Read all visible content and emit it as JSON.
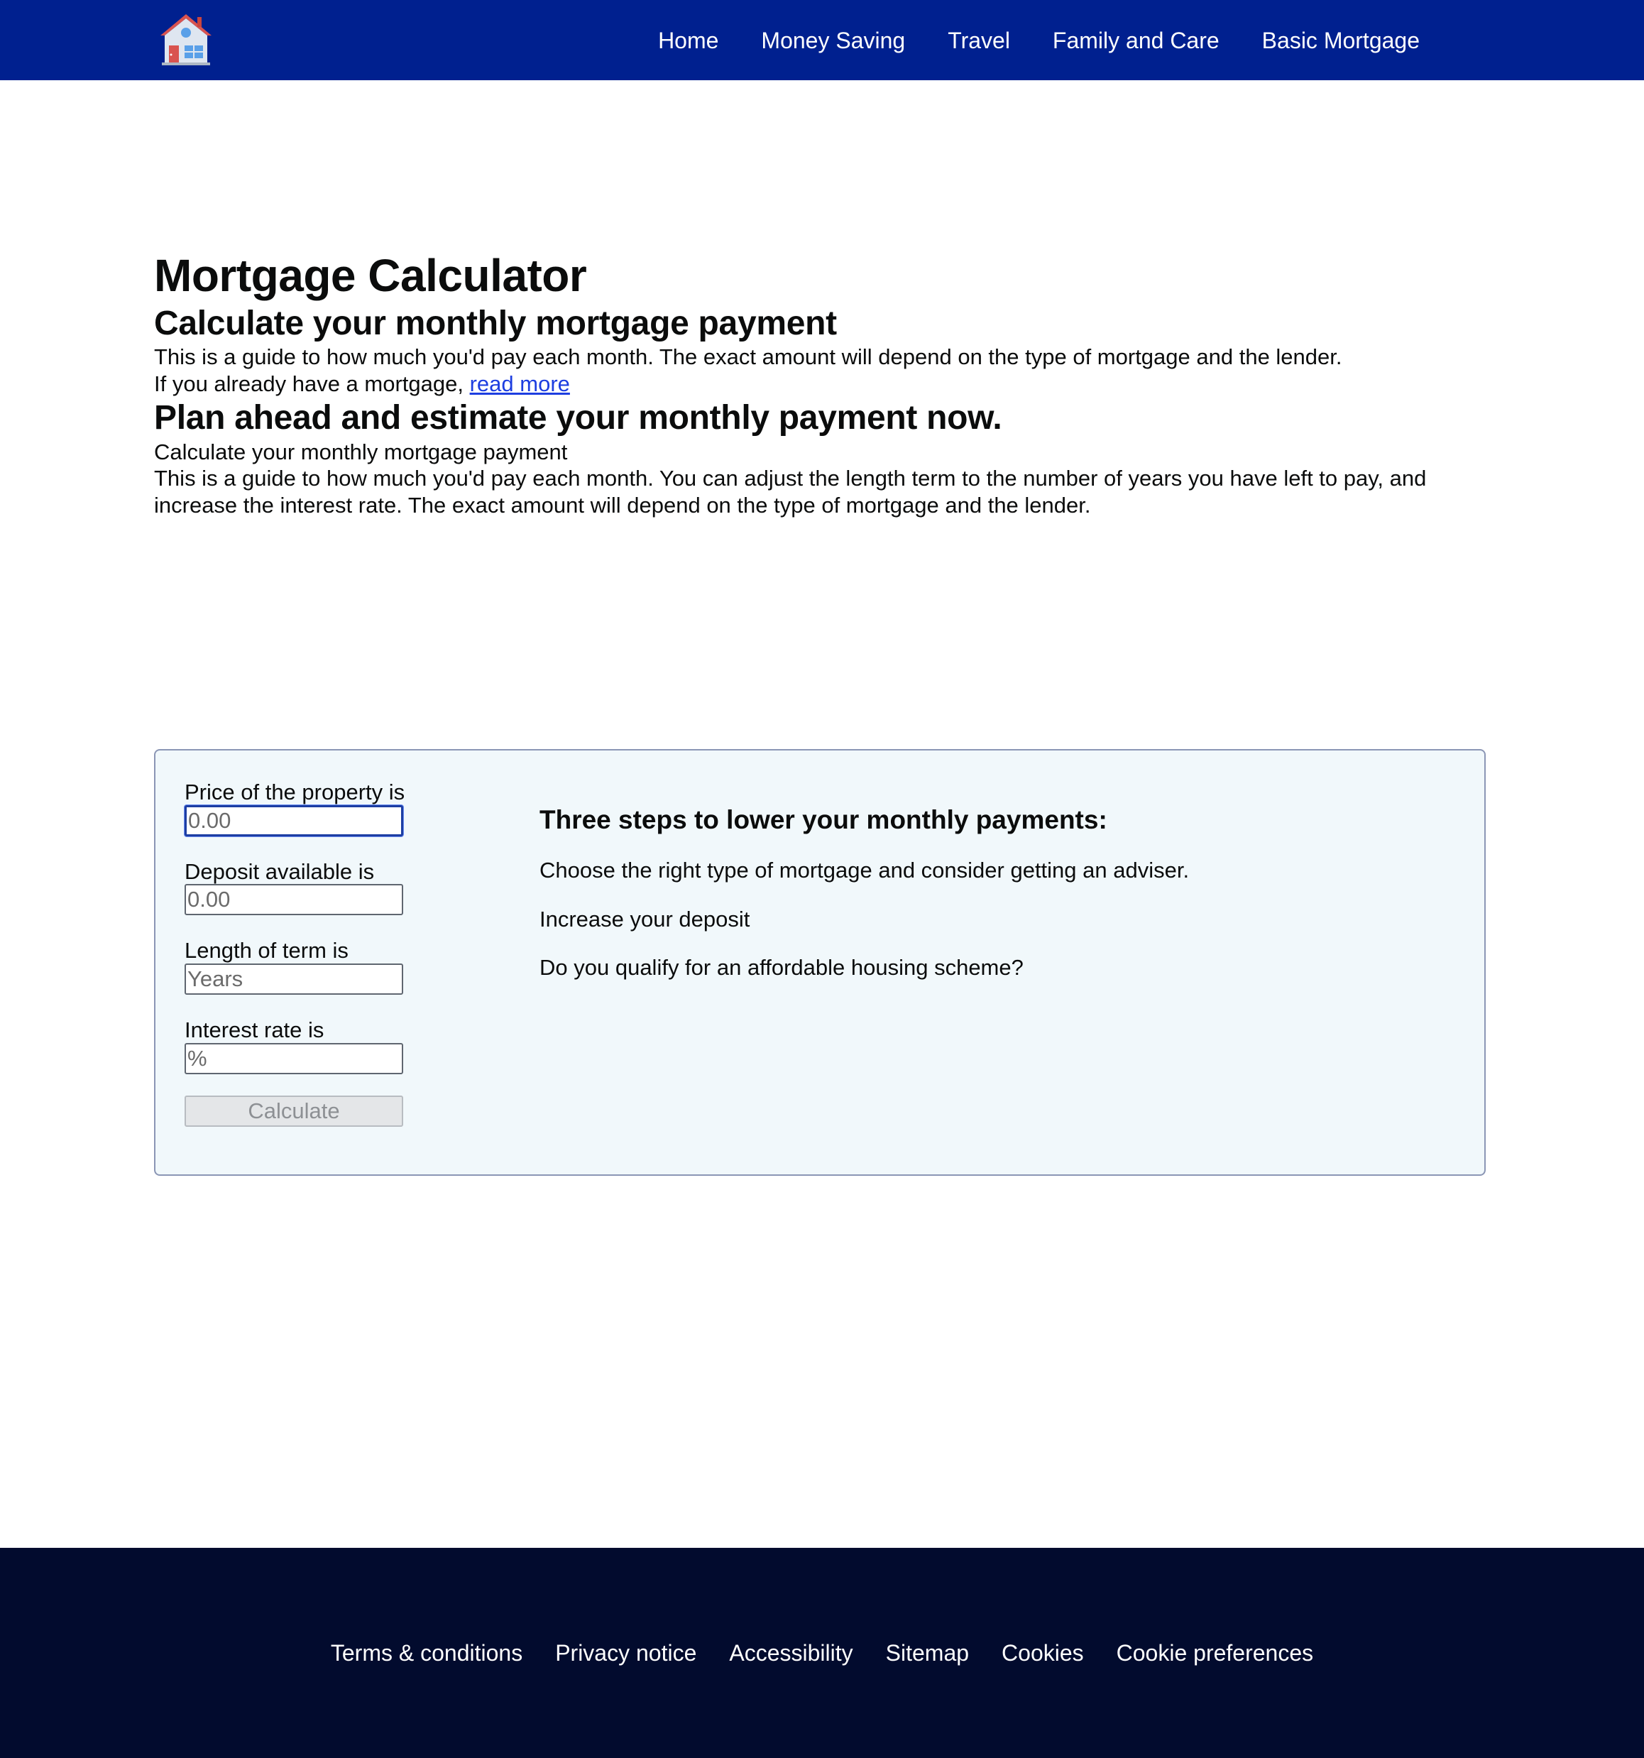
{
  "header": {
    "logo_icon": "house-icon",
    "nav": [
      {
        "label": "Home"
      },
      {
        "label": "Money Saving"
      },
      {
        "label": "Travel"
      },
      {
        "label": "Family and Care"
      },
      {
        "label": "Basic Mortgage"
      }
    ]
  },
  "main": {
    "title": "Mortgage Calculator",
    "section1": {
      "heading": "Calculate your monthly mortgage payment",
      "intro": "This is a guide to how much you'd pay each month. The exact amount will depend on the type of mortgage and the lender.",
      "existing_prefix": "If you already have a mortgage, ",
      "existing_link": "read more"
    },
    "section2": {
      "heading": "Plan ahead and estimate your monthly payment now.",
      "subtitle": "Calculate your monthly mortgage payment",
      "intro": "This is a guide to how much you'd pay each month. You can adjust the length term to the number of years you have left to pay, and increase the interest rate. The exact amount will depend on the type of mortgage and the lender."
    }
  },
  "calculator": {
    "fields": [
      {
        "label": "Price of the property is",
        "placeholder": "0.00",
        "value": ""
      },
      {
        "label": "Deposit available is",
        "placeholder": "0.00",
        "value": ""
      },
      {
        "label": "Length of term is",
        "placeholder": "Years",
        "value": ""
      },
      {
        "label": "Interest rate is",
        "placeholder": "%",
        "value": ""
      }
    ],
    "button_label": "Calculate",
    "tips": {
      "heading": "Three steps to lower your monthly payments:",
      "items": [
        "Choose the right type of mortgage and consider getting an adviser.",
        "Increase your deposit",
        "Do you qualify for an affordable housing scheme?"
      ]
    }
  },
  "footer": {
    "links": [
      {
        "label": "Terms & conditions"
      },
      {
        "label": "Privacy notice"
      },
      {
        "label": "Accessibility"
      },
      {
        "label": "Sitemap"
      },
      {
        "label": "Cookies"
      },
      {
        "label": "Cookie preferences"
      }
    ]
  },
  "colors": {
    "header_bg": "#00208f",
    "footer_bg": "#020b2e",
    "panel_bg": "#f1f8fb",
    "link": "#1d3ee0"
  }
}
